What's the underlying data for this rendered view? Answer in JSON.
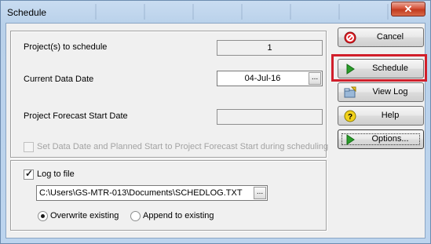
{
  "window": {
    "title": "Schedule",
    "close_glyph": "✕"
  },
  "top_group": {
    "projects_label": "Project(s) to schedule",
    "projects_value": "1",
    "data_date_label": "Current Data Date",
    "data_date_value": "04-Jul-16",
    "forecast_label": "Project Forecast Start Date",
    "forecast_value": "",
    "set_dates_label": "Set Data Date and Planned Start to Project Forecast Start during scheduling",
    "set_dates_checked": false
  },
  "bottom_group": {
    "log_label": "Log to file",
    "log_checked": true,
    "log_path": "C:\\Users\\GS-MTR-013\\Documents\\SCHEDLOG.TXT",
    "overwrite_label": "Overwrite existing",
    "append_label": "Append to existing",
    "selected": "overwrite"
  },
  "ellipsis": "...",
  "buttons": {
    "cancel": "Cancel",
    "schedule": "Schedule",
    "view_log": "View Log",
    "help": "Help",
    "options": "Options..."
  },
  "colors": {
    "highlight": "#d11f2b",
    "cancel_icon": "#e11d24",
    "play_icon": "#2a9d2a",
    "help_icon": "#f2d21b"
  }
}
